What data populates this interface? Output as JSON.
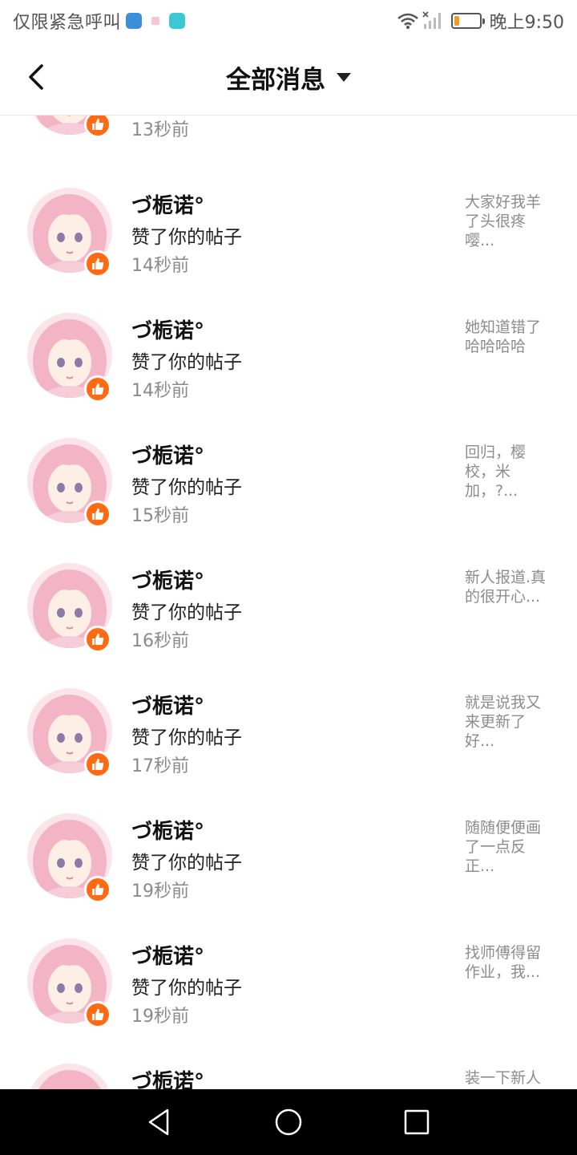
{
  "status_bar": {
    "carrier": "仅限紧急呼叫",
    "time": "晚上9:50",
    "battery_level": 0.2,
    "app_icon_colors": [
      "#3b8fd8",
      "#f7c6d6",
      "#3cc8d2"
    ]
  },
  "header": {
    "title": "全部消息"
  },
  "colors": {
    "like_badge": "#ff6a13",
    "avatar_hair": "#f3b4c6"
  },
  "messages": [
    {
      "name": "",
      "action": "",
      "time": "13秒前",
      "preview": ""
    },
    {
      "name": "づ栀诺°",
      "action": "赞了你的帖子",
      "time": "14秒前",
      "preview": "大家好我羊了头很疼嘤..."
    },
    {
      "name": "づ栀诺°",
      "action": "赞了你的帖子",
      "time": "14秒前",
      "preview": "她知道错了哈哈哈哈"
    },
    {
      "name": "づ栀诺°",
      "action": "赞了你的帖子",
      "time": "15秒前",
      "preview": "回归，樱校，米加，?..."
    },
    {
      "name": "づ栀诺°",
      "action": "赞了你的帖子",
      "time": "16秒前",
      "preview": "新人报道.真的很开心..."
    },
    {
      "name": "づ栀诺°",
      "action": "赞了你的帖子",
      "time": "17秒前",
      "preview": "就是说我又来更新了好..."
    },
    {
      "name": "づ栀诺°",
      "action": "赞了你的帖子",
      "time": "19秒前",
      "preview": "随随便便画了一点反正..."
    },
    {
      "name": "づ栀诺°",
      "action": "赞了你的帖子",
      "time": "19秒前",
      "preview": "找师傅得留作业，我..."
    },
    {
      "name": "づ栀诺°",
      "action": "",
      "time": "",
      "preview": "装一下新人"
    }
  ]
}
